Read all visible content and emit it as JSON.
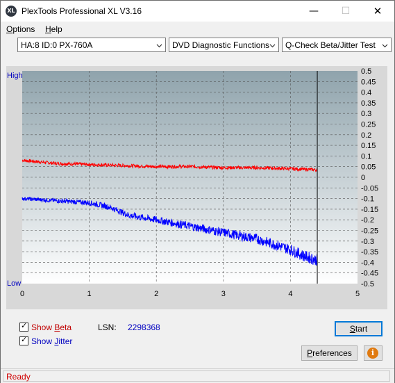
{
  "window": {
    "title": "PlexTools Professional XL V3.16",
    "app_icon_text": "XL",
    "controls": {
      "minimize": "—",
      "maximize": "☐",
      "close": "✕"
    }
  },
  "menu": {
    "options": {
      "first": "O",
      "rest": "ptions"
    },
    "help": {
      "first": "H",
      "rest": "elp"
    }
  },
  "toolbar": {
    "drive": "HA:8 ID:0  PX-760A",
    "function": "DVD Diagnostic Functions",
    "test": "Q-Check Beta/Jitter Test"
  },
  "graph": {
    "high_label": "High",
    "low_label": "Low",
    "x_ticks": [
      "0",
      "1",
      "2",
      "3",
      "4",
      "5"
    ],
    "y_ticks": [
      "0.5",
      "0.45",
      "0.4",
      "0.35",
      "0.3",
      "0.25",
      "0.2",
      "0.15",
      "0.1",
      "0.05",
      "0",
      "-0.05",
      "-0.1",
      "-0.15",
      "-0.2",
      "-0.25",
      "-0.3",
      "-0.35",
      "-0.4",
      "-0.45",
      "-0.5"
    ]
  },
  "chart_data": {
    "type": "line",
    "x_range": [
      0,
      5
    ],
    "y_range": [
      -0.5,
      0.5
    ],
    "grid": true,
    "cursor_x": 4.4,
    "series": [
      {
        "name": "Beta",
        "color": "#ff0000",
        "x": [
          0,
          0.5,
          1.0,
          1.5,
          2.0,
          2.5,
          3.0,
          3.5,
          4.0,
          4.4
        ],
        "y": [
          0.08,
          0.065,
          0.06,
          0.055,
          0.05,
          0.05,
          0.045,
          0.045,
          0.04,
          0.035
        ]
      },
      {
        "name": "Jitter",
        "color": "#0000ff",
        "x": [
          0,
          0.5,
          1.0,
          1.3,
          1.6,
          2.0,
          2.5,
          3.0,
          3.5,
          4.0,
          4.2,
          4.4
        ],
        "y": [
          -0.1,
          -0.11,
          -0.12,
          -0.14,
          -0.18,
          -0.2,
          -0.23,
          -0.26,
          -0.29,
          -0.34,
          -0.37,
          -0.39
        ]
      }
    ]
  },
  "controls": {
    "show_beta": {
      "checked": true,
      "prefix": "Show ",
      "first": "B",
      "rest": "eta"
    },
    "show_jitter": {
      "checked": true,
      "prefix": "Show ",
      "first": "J",
      "rest": "itter"
    },
    "lsn_label": "LSN:",
    "lsn_value": "2298368",
    "start": {
      "first": "S",
      "rest": "tart"
    },
    "preferences": {
      "first": "P",
      "rest": "references"
    },
    "info_icon_text": "i"
  },
  "status": {
    "text": "Ready"
  },
  "colors": {
    "beta": "#ff0000",
    "jitter": "#0000ff",
    "label_blue": "#0000c0",
    "beta_label": "#c00000"
  }
}
